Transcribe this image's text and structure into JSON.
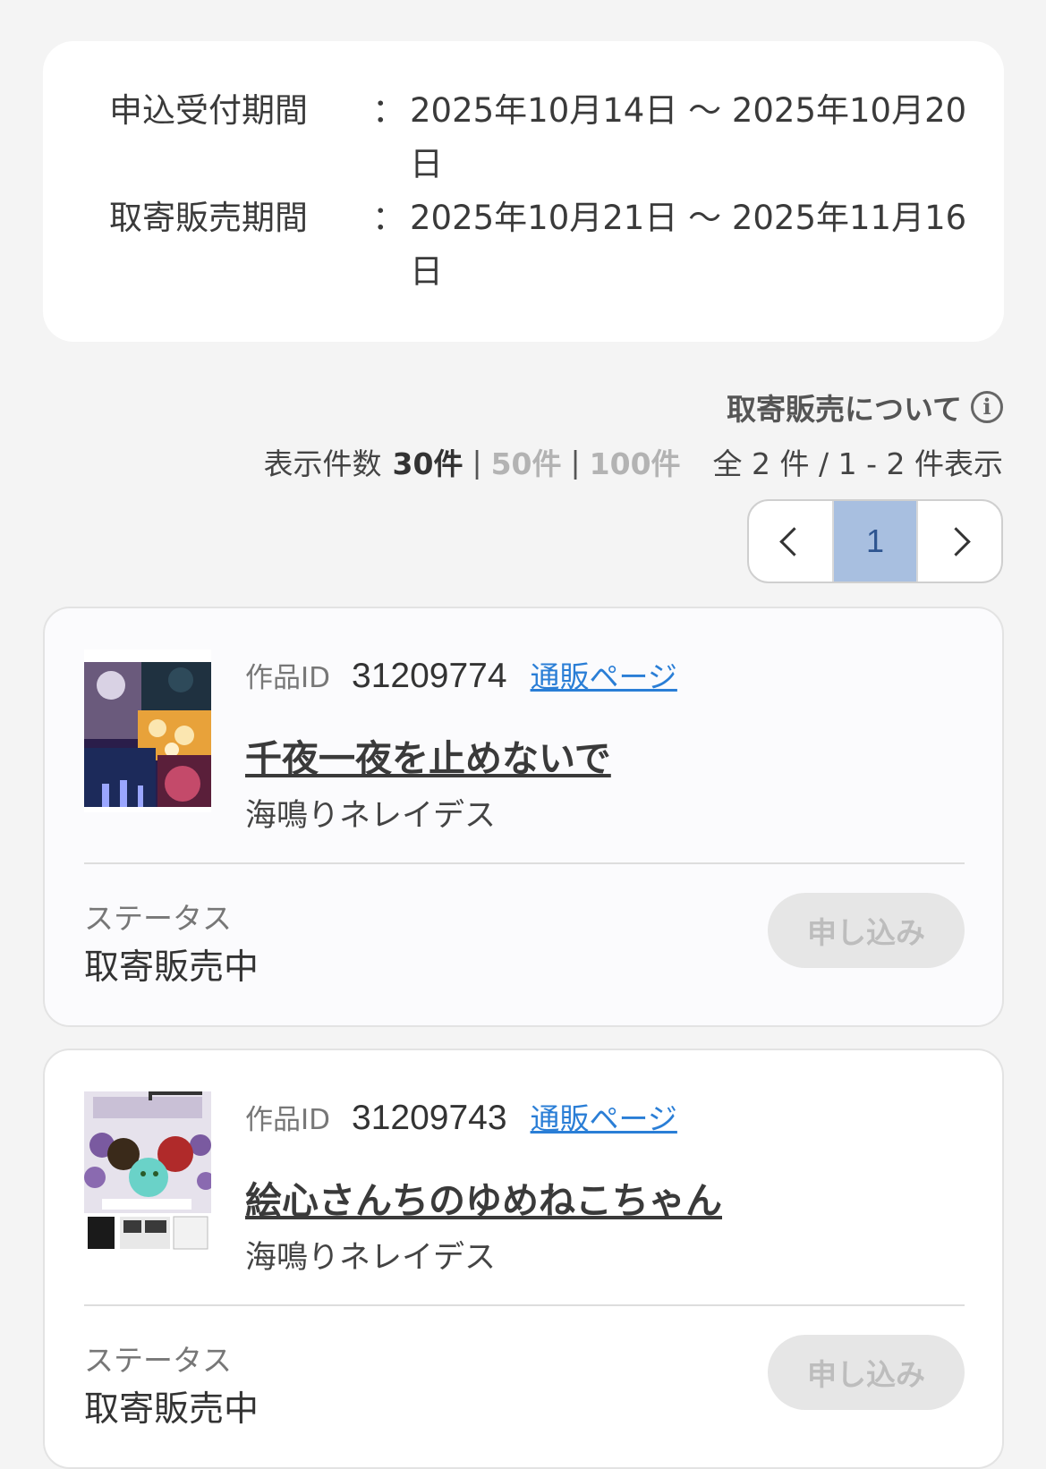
{
  "periods": [
    {
      "label": "申込受付期間",
      "colon": "：",
      "value": "2025年10月14日 〜 2025年10月20日"
    },
    {
      "label": "取寄販売期間",
      "colon": "：",
      "value": "2025年10月21日 〜 2025年11月16日"
    }
  ],
  "about": {
    "label": "取寄販売について",
    "icon": "info-icon"
  },
  "display_count": {
    "label": "表示件数",
    "current": "30件",
    "options": [
      "50件",
      "100件"
    ],
    "separator": "|",
    "total_text": "全 2 件 / 1 - 2 件表示"
  },
  "pagination": {
    "current_page": "1",
    "prev_icon": "chevron-left-icon",
    "next_icon": "chevron-right-icon"
  },
  "items": [
    {
      "id_label": "作品ID",
      "id": "31209774",
      "shop_link": "通販ページ",
      "title": "千夜一夜を止めないで",
      "author": "海鳴りネレイデス",
      "status_label": "ステータス",
      "status": "取寄販売中",
      "apply_label": "申し込み"
    },
    {
      "id_label": "作品ID",
      "id": "31209743",
      "shop_link": "通販ページ",
      "title": "絵心さんちのゆめねこちゃん",
      "author": "海鳴りネレイデス",
      "status_label": "ステータス",
      "status": "取寄販売中",
      "apply_label": "申し込み"
    }
  ],
  "colors": {
    "background": "#f4f4f4",
    "card": "#ffffff",
    "link": "#2a7ed6",
    "page_active": "#a8bfe0",
    "button_disabled": "#e6e6e6"
  }
}
